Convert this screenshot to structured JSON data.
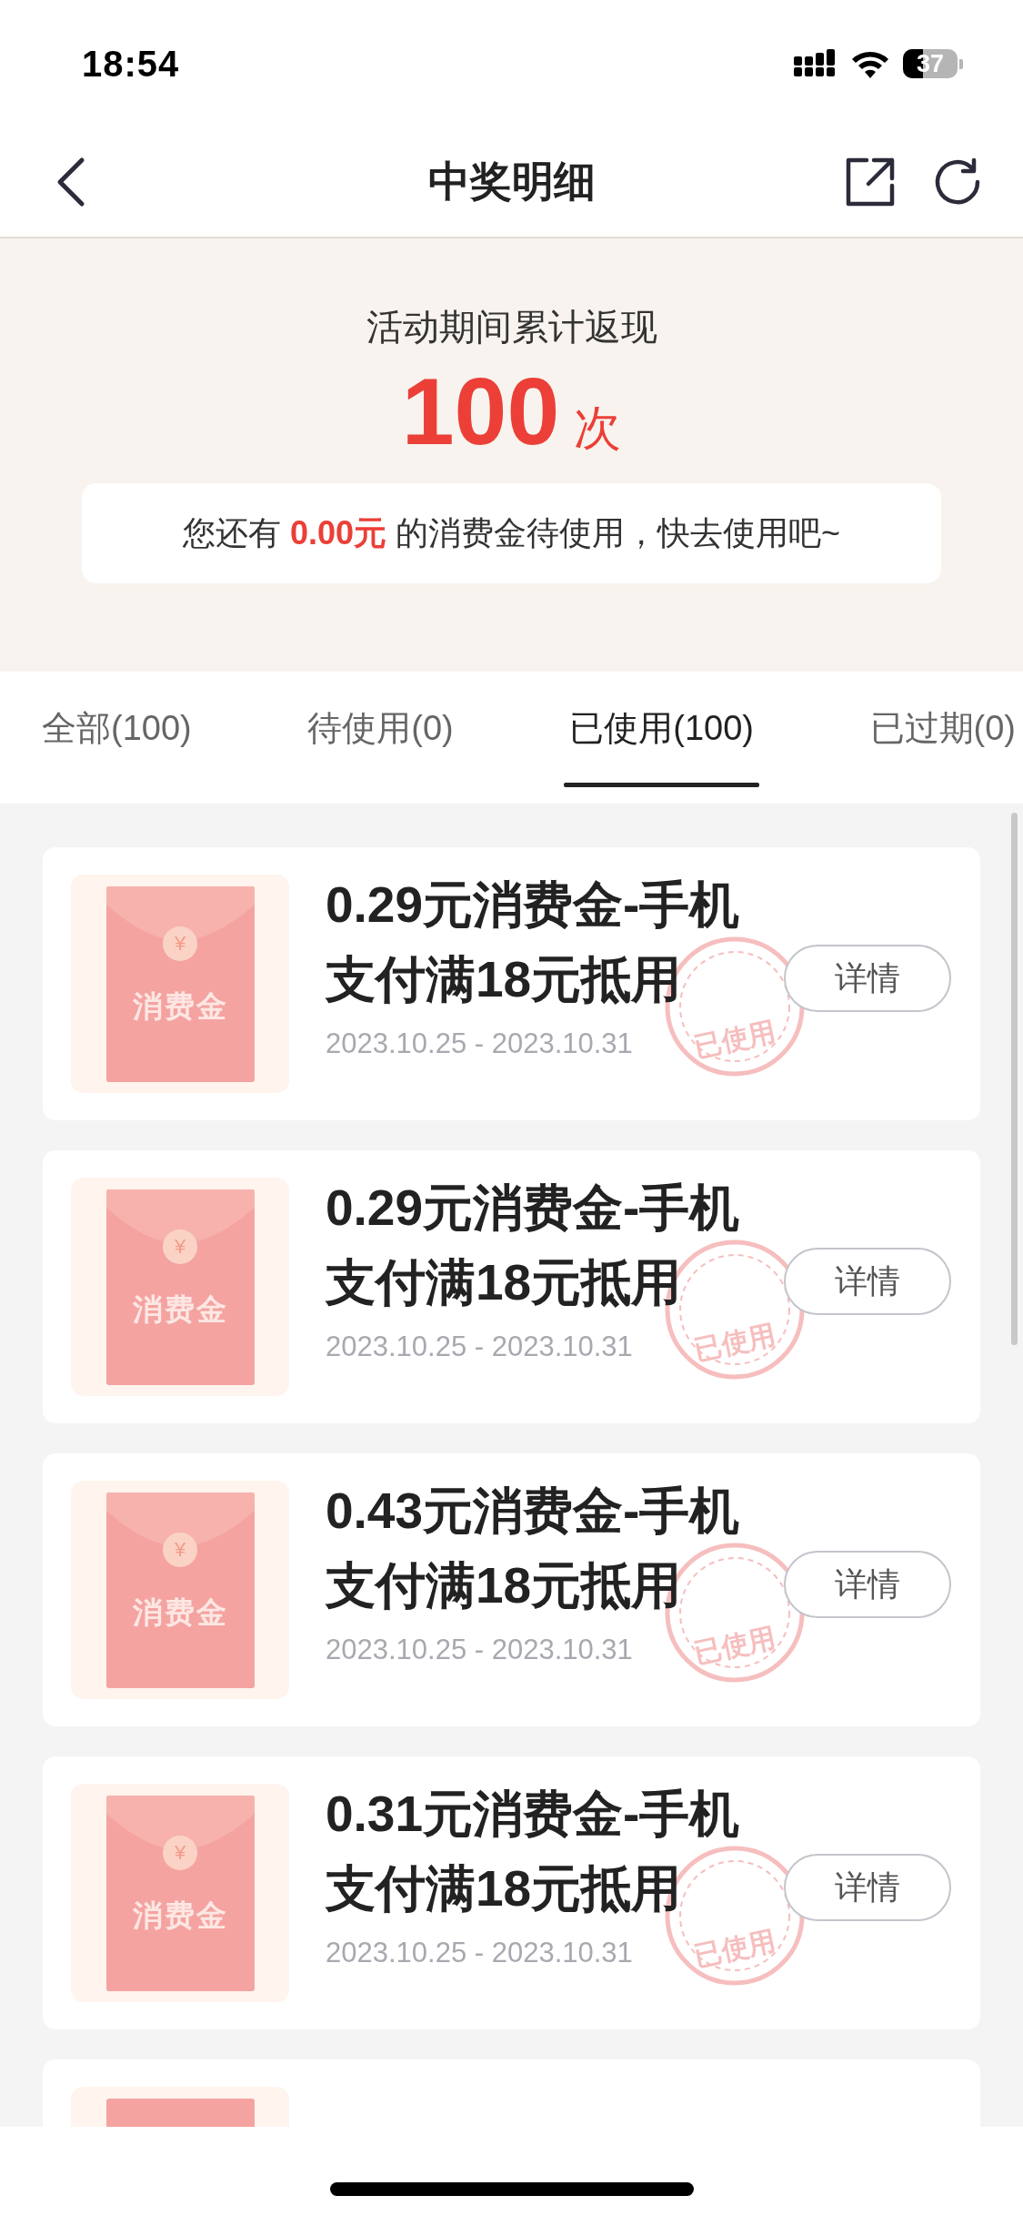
{
  "status_bar": {
    "time": "18:54",
    "battery": "37"
  },
  "nav": {
    "title": "中奖明细"
  },
  "summary": {
    "label": "活动期间累计返现",
    "count": "100",
    "unit": "次",
    "notice": "您还有 **0.00元** 的消费金待使用，快去使用吧~"
  },
  "tabs": [
    {
      "label": "全部(100)",
      "selected": false
    },
    {
      "label": "待使用(0)",
      "selected": false
    },
    {
      "label": "已使用(100)",
      "selected": true
    },
    {
      "label": "已过期(0)",
      "selected": false
    }
  ],
  "coupons": [
    {
      "envelope_label": "消费金",
      "yen": "¥",
      "title": "0.29元消费金-手机支付满18元抵用",
      "stamp": "已使用",
      "date": "2023.10.25 - 2023.10.31",
      "button": "详情"
    },
    {
      "envelope_label": "消费金",
      "yen": "¥",
      "title": "0.29元消费金-手机支付满18元抵用",
      "stamp": "已使用",
      "date": "2023.10.25 - 2023.10.31",
      "button": "详情"
    },
    {
      "envelope_label": "消费金",
      "yen": "¥",
      "title": "0.43元消费金-手机支付满18元抵用",
      "stamp": "已使用",
      "date": "2023.10.25 - 2023.10.31",
      "button": "详情"
    },
    {
      "envelope_label": "消费金",
      "yen": "¥",
      "title": "0.31元消费金-手机支付满18元抵用",
      "stamp": "已使用",
      "date": "2023.10.25 - 2023.10.31",
      "button": "详情"
    }
  ],
  "more_below": true
}
